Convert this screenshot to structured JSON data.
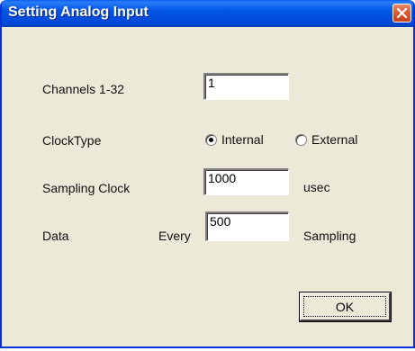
{
  "window": {
    "title": "Setting Analog Input"
  },
  "form": {
    "channels": {
      "label": "Channels 1-32",
      "value": "1"
    },
    "clock_type": {
      "label": "ClockType",
      "options": [
        "Internal",
        "External"
      ],
      "selected": "Internal"
    },
    "sampling_clock": {
      "label": "Sampling Clock",
      "value": "1000",
      "unit": "usec"
    },
    "data": {
      "label": "Data",
      "prefix": "Every",
      "value": "500",
      "suffix": "Sampling"
    }
  },
  "buttons": {
    "ok_label": "OK"
  },
  "icons": {
    "close": "close-icon"
  },
  "colors": {
    "titlebar": "#0055e5",
    "close_button": "#d9582f",
    "dialog_background": "#ece9d8"
  }
}
